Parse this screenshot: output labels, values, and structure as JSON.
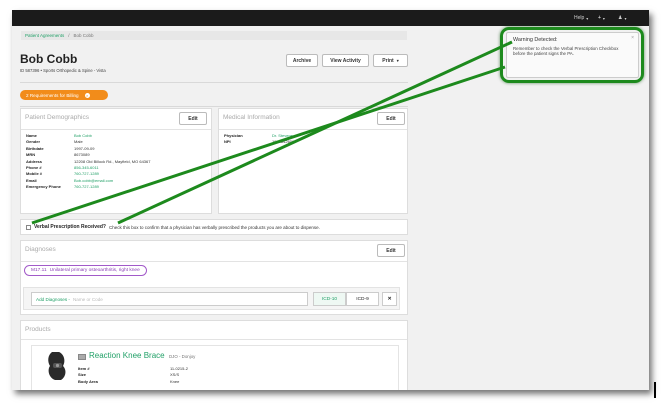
{
  "topbar": {
    "help": "Help",
    "plus": "+",
    "user": "♟"
  },
  "breadcrumb": {
    "parent": "Patient Agreements",
    "sep": "/",
    "current": "Bob Cobb"
  },
  "patient": {
    "name": "Bob Cobb",
    "id_line": "ID 587396 • Sports Orthopedic & Spine - Vista"
  },
  "actions": {
    "archive": "Archive",
    "view_activity": "View Activity",
    "print": "Print"
  },
  "requirements": {
    "label": "2 Requirements for Billing"
  },
  "demographics": {
    "title": "Patient Demographics",
    "edit": "Edit",
    "rows": [
      {
        "label": "Name",
        "value": "Bob Cobb",
        "link": true
      },
      {
        "label": "Gender",
        "value": "Male",
        "link": false
      },
      {
        "label": "Birthdate",
        "value": "1997-09-09",
        "link": false
      },
      {
        "label": "MRN",
        "value": "8673089",
        "link": false
      },
      {
        "label": "Address",
        "value": "12208 Old Billock Rd., Mayfield, MO 64367",
        "link": false
      },
      {
        "label": "Phone #",
        "value": "856-345-6011",
        "link": true
      },
      {
        "label": "Mobile #",
        "value": "760-727-1289",
        "link": true
      },
      {
        "label": "Email",
        "value": "Bob.cobb@email.com",
        "link": true
      },
      {
        "label": "Emergency Phone",
        "value": "760-727-1289",
        "link": true
      }
    ]
  },
  "medical": {
    "title": "Medical Information",
    "edit": "Edit",
    "rows": [
      {
        "label": "Physician",
        "value": "Dr. Stevens",
        "link": true
      },
      {
        "label": "NPI",
        "value": "1952842606",
        "link": false
      }
    ]
  },
  "verbal": {
    "label": "Verbal Prescription Received?",
    "help": "Check this box to confirm that a physician has verbally prescribed the products you are about to dispense."
  },
  "diagnoses": {
    "title": "Diagnoses",
    "edit": "Edit",
    "pill": {
      "code": "M17.11",
      "text": "Unilateral primary osteoarthritis, right knee"
    },
    "add_label": "Add Diagnoses -",
    "placeholder": "Name or Code",
    "icd10": "ICD-10",
    "icd9": "ICD-9",
    "clear": "✕"
  },
  "products": {
    "title": "Products",
    "item": {
      "name": "Reaction Knee Brace",
      "brand": "DJO - Donjoy",
      "fields": [
        {
          "label": "Item #",
          "value": "11-0215-2"
        },
        {
          "label": "Size",
          "value": "XS/S"
        },
        {
          "label": "Body Area",
          "value": "Knee"
        }
      ]
    }
  },
  "warning": {
    "title": "Warning Detected:",
    "message": "Remember to check the Verbal Prescription Checkbox before the patient signs the PA.",
    "close": "×"
  },
  "colors": {
    "accent": "#21a067",
    "badge": "#f28c1a",
    "annotation": "#1d8a1d",
    "diagnosis": "#8a3fb6"
  }
}
